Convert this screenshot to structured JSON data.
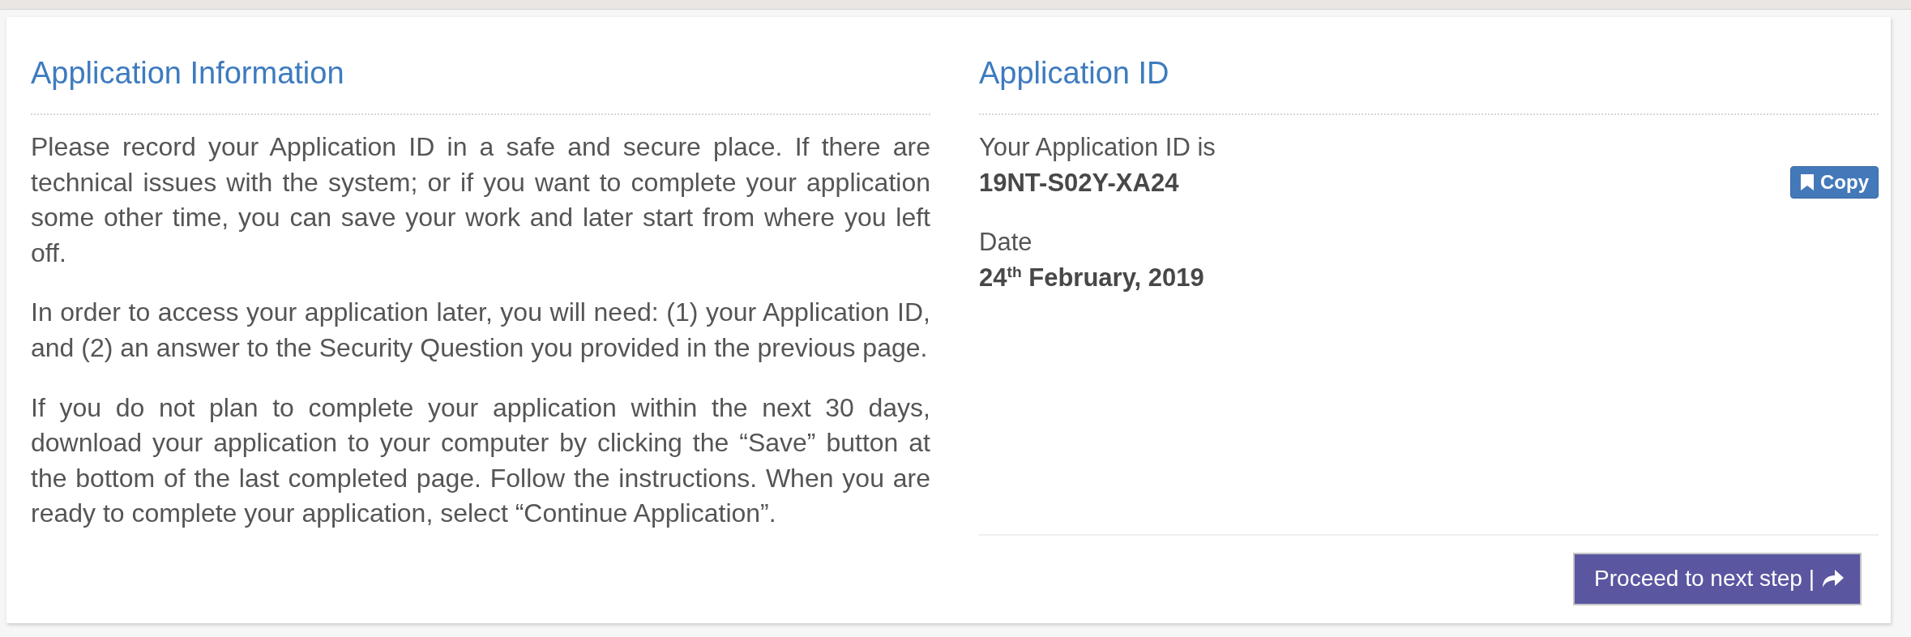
{
  "info_panel": {
    "heading": "Application Information",
    "paragraphs": [
      "Please record your Application ID in a safe and secure place. If there are technical issues with the system; or if you want to complete your application some other time, you can save your work and later start from where you left off.",
      "In order to access your application later, you will need: (1) your Application ID, and (2) an answer to the Security Question you provided in the previous page.",
      "If you do not plan to complete your application within the next 30 days, download your application to your computer by clicking the “Save” button at the bottom of the last completed page. Follow the instructions. When you are ready to complete your application, select “Continue Application”."
    ]
  },
  "id_panel": {
    "heading": "Application ID",
    "fields": [
      {
        "label": "Your Application ID is",
        "value": "19NT-S02Y-XA24",
        "action": "Copy"
      },
      {
        "label": "Date",
        "value": "24$^{th}$ February, 2019"
      }
    ]
  },
  "footer": {
    "button": "Proceed to next step |"
  }
}
